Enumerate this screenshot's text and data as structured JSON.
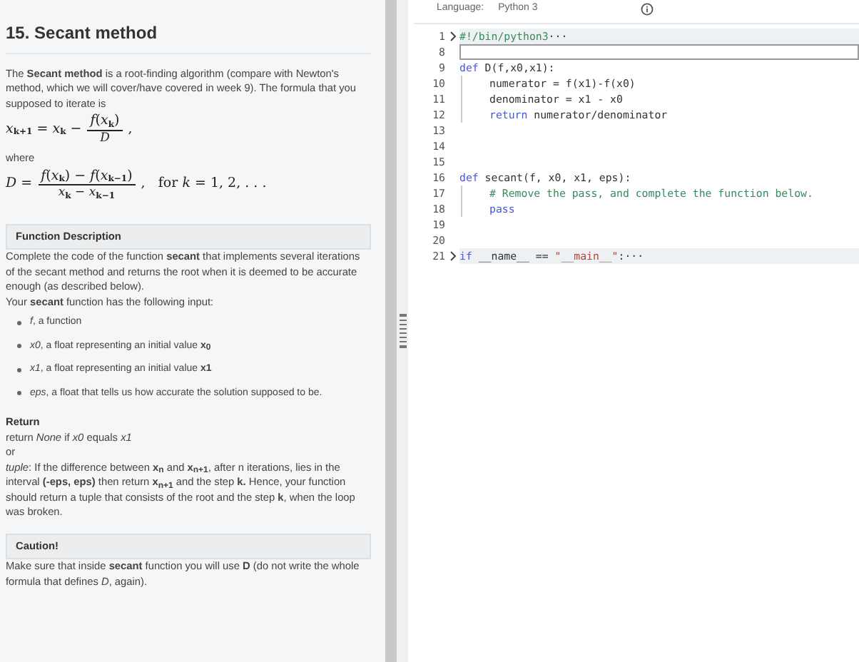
{
  "problem": {
    "title": "15. Secant method",
    "intro": "The **Secant method** is a root-finding algorithm (compare with Newton's method, which we will cover/have covered in week 9). The formula that you supposed to iterate is",
    "formula_1": {
      "lhs": "*x*$_{k+1}$ = *x*$_{k}$ −",
      "numerator": "*f*(*x*$_{k}$)",
      "denominator": "*D*",
      "tail": ","
    },
    "where": "where",
    "formula_2": {
      "lhs": "*D* =",
      "numerator": "*f*(*x*$_{k}$) − *f*(*x*$_{k−1}$)",
      "denominator": "*x*$_{k}$ − *x*$_{k−1}$",
      "tail": ",   for *k* = 1, 2, . . ."
    },
    "function_description": {
      "heading": "Function Description",
      "text": "Complete the code of the function **secant** that implements several iterations of the secant method and returns the root when it is deemed to be accurate enough (as described below).",
      "input_text": "Your **secant** function has the following input:",
      "inputs": [
        "*f*, a function",
        "*x0*, a float representing an initial value **x**$_{0}$",
        "*x1*, a float representing an initial value **x1**",
        "*eps*, a float that tells us how accurate the solution supposed to be."
      ]
    },
    "return": {
      "heading": "Return",
      "line_1": "return *None* if *x0* equals *x1*",
      "line_2": "or",
      "text": "*tuple*: If the difference between **x**$_{n}$ and **x**$_{n+1}$, after n iterations, lies in the interval **(-eps, eps)** then return **x**$_{n+1}$ and the step **k.** Hence, your function should return a tuple that consists of the root and the step **k**, when the loop was broken."
    },
    "caution": {
      "heading": "Caution!",
      "text": "Make sure that inside **secant** function you will use **D** (do not write the whole formula that defines *D*, again)."
    }
  },
  "editor": {
    "language_label": "Language:",
    "language": "Python 3",
    "lines": [
      {
        "number": "1",
        "folded": true,
        "current": false,
        "indent": false,
        "tokens": [
          {
            "text": "#!/bin/python3",
            "kind": "comment"
          },
          {
            "text": "···",
            "kind": "plain"
          }
        ]
      },
      {
        "number": "8",
        "folded": false,
        "current": true,
        "indent": false
      },
      {
        "number": "9",
        "folded": false,
        "current": false,
        "indent": false,
        "tokens": [
          {
            "text": "def",
            "kind": "keyword"
          },
          {
            "text": " D(f,x0,x1):",
            "kind": "plain"
          }
        ]
      },
      {
        "number": "10",
        "folded": false,
        "current": false,
        "indent": true,
        "tokens": [
          {
            "text": "numerator = f(x1)-f(x0)",
            "kind": "plain"
          }
        ]
      },
      {
        "number": "11",
        "folded": false,
        "current": false,
        "indent": true,
        "tokens": [
          {
            "text": "denominator = x1 - x0",
            "kind": "plain"
          }
        ]
      },
      {
        "number": "12",
        "folded": false,
        "current": false,
        "indent": true,
        "tokens": [
          {
            "text": "return",
            "kind": "keyword"
          },
          {
            "text": " numerator/denominator",
            "kind": "plain"
          }
        ]
      },
      {
        "number": "13",
        "folded": false,
        "current": false,
        "indent": false
      },
      {
        "number": "14",
        "folded": false,
        "current": false,
        "indent": false
      },
      {
        "number": "15",
        "folded": false,
        "current": false,
        "indent": false
      },
      {
        "number": "16",
        "folded": false,
        "current": false,
        "indent": false,
        "tokens": [
          {
            "text": "def",
            "kind": "keyword"
          },
          {
            "text": " secant(f, x0, x1, eps):",
            "kind": "plain"
          }
        ]
      },
      {
        "number": "17",
        "folded": false,
        "current": false,
        "indent": true,
        "tokens": [
          {
            "text": "# Remove the pass, and complete the function below.",
            "kind": "comment"
          }
        ]
      },
      {
        "number": "18",
        "folded": false,
        "current": false,
        "indent": true,
        "tokens": [
          {
            "text": "pass",
            "kind": "keyword"
          }
        ]
      },
      {
        "number": "19",
        "folded": false,
        "current": false,
        "indent": false
      },
      {
        "number": "20",
        "folded": false,
        "current": false,
        "indent": false
      },
      {
        "number": "21",
        "folded": true,
        "current": false,
        "indent": false,
        "tokens": [
          {
            "text": "if",
            "kind": "keyword"
          },
          {
            "text": " __name__ == ",
            "kind": "plain"
          },
          {
            "text": "\"__main__\"",
            "kind": "string"
          },
          {
            "text": ":",
            "kind": "plain"
          },
          {
            "text": "···",
            "kind": "plain"
          }
        ]
      }
    ]
  }
}
